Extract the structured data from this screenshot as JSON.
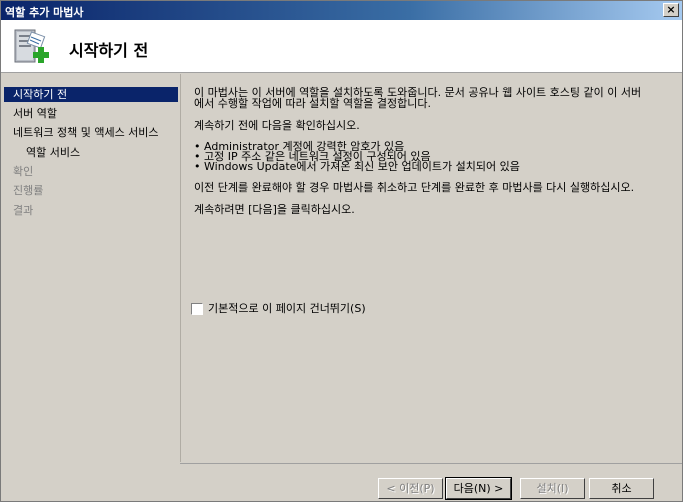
{
  "window": {
    "title": "역할 추가 마법사",
    "close_label": "×"
  },
  "header": {
    "page_title": "시작하기 전",
    "icon": "server-add-icon"
  },
  "sidebar": {
    "items": [
      {
        "label": "시작하기 전",
        "state": "active"
      },
      {
        "label": "서버 역할",
        "state": "normal"
      },
      {
        "label": "네트워크 정책 및 액세스 서비스",
        "state": "normal"
      },
      {
        "label": "역할 서비스",
        "state": "normal"
      },
      {
        "label": "확인",
        "state": "disabled"
      },
      {
        "label": "진행률",
        "state": "disabled"
      },
      {
        "label": "결과",
        "state": "disabled"
      }
    ]
  },
  "content": {
    "intro_line1": "이 마법사는 이 서버에 역할을 설치하도록 도와줍니다. 문서 공유나 웹 사이트 호스팅 같이 이 서버",
    "intro_line2": "에서 수행할 작업에 따라 설치할 역할을 결정합니다.",
    "verify_heading": "계속하기 전에 다음을 확인하십시오.",
    "bullets": [
      "Administrator 계정에 강력한 암호가 있음",
      "고정 IP 주소 같은 네트워크 설정이 구성되어 있음",
      "Windows Update에서 가져온 최신 보안 업데이트가 설치되어 있음"
    ],
    "cancel_note": "이전 단계를 완료해야 할 경우 마법사를 취소하고 단계를 완료한 후 마법사를 다시 실행하십시오.",
    "continue_note": "계속하려면 [다음]을 클릭하십시오.",
    "skip_checkbox_label": "기본적으로 이 페이지 건너뛰기(S)",
    "skip_checked": false
  },
  "footer": {
    "prev_label": "< 이전(P)",
    "next_label": "다음(N) >",
    "install_label": "설치(I)",
    "cancel_label": "취소"
  },
  "colors": {
    "titlebar_start": "#0a246a",
    "selection": "#0a246a",
    "face": "#d4d0c8"
  }
}
